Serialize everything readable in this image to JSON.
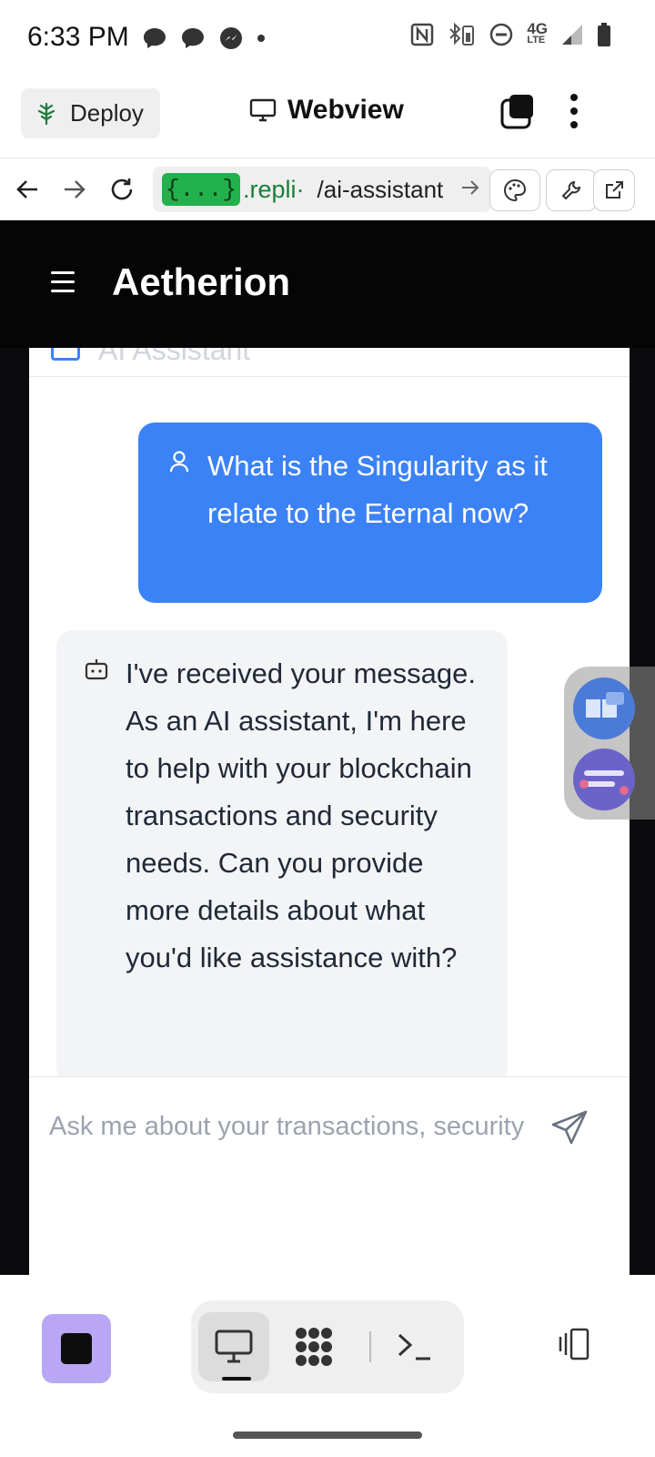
{
  "status_bar": {
    "time": "6:33 PM",
    "network": "4G",
    "network_sub": "LTE"
  },
  "top_bar": {
    "deploy_label": "Deploy",
    "webview_label": "Webview"
  },
  "url_bar": {
    "badge": "{...}",
    "host": ".repli·",
    "path": "/ai-assistant"
  },
  "app": {
    "title": "Aetherion",
    "chat_header": "AI Assistant",
    "user_message": "What is the Singularity as it relate to the Eternal now?",
    "ai_message": "I've received your message. As an AI assistant, I'm here to help with your blockchain transactions and security needs. Can you provide more details about what you'd like assistance with?",
    "input_placeholder": "Ask me about your transactions, security"
  },
  "colors": {
    "user_bubble": "#3b82f6",
    "ai_bubble": "#f3f4f6",
    "header_bg": "#050506",
    "stop_button": "#b9a7f5",
    "url_badge": "#22b14c"
  }
}
